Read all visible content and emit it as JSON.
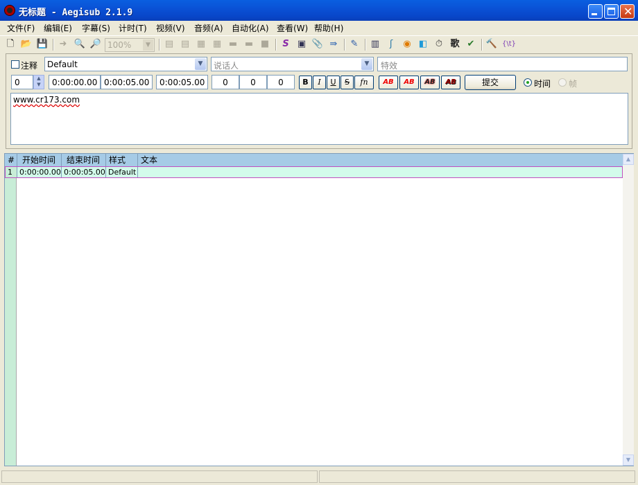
{
  "window": {
    "title": "无标题 - Aegisub 2.1.9"
  },
  "menu": [
    "文件(F)",
    "编辑(E)",
    "字幕(S)",
    "计时(T)",
    "视频(V)",
    "音频(A)",
    "自动化(A)",
    "查看(W)",
    "帮助(H)"
  ],
  "toolbar": {
    "zoom": "100%"
  },
  "edit": {
    "comment_label": "注释",
    "style": "Default",
    "actor_placeholder": "说话人",
    "effect_placeholder": "特效",
    "layer": "0",
    "start_time": "0:00:00.00",
    "end_time": "0:00:05.00",
    "duration": "0:00:05.00",
    "margin_l": "0",
    "margin_r": "0",
    "margin_v": "0",
    "bold": "B",
    "italic": "I",
    "underline": "U",
    "strike": "S",
    "font": "fn",
    "color_labels": [
      "AB",
      "AB",
      "AB",
      "AB"
    ],
    "commit_label": "提交",
    "time_label": "时间",
    "frame_label": "帧",
    "text": "www.cr173.com"
  },
  "grid": {
    "headers": [
      "#",
      "开始时间",
      "结束时间",
      "样式",
      "文本"
    ],
    "rows": [
      {
        "num": "1",
        "start": "0:00:00.00",
        "end": "0:00:05.00",
        "style": "Default",
        "text": ""
      }
    ]
  },
  "colors": {
    "titlebar": "#0a52d6",
    "grid_header": "#a6cbe6",
    "selected_row": "#d3fbeb",
    "gutter": "#c8edd7"
  }
}
